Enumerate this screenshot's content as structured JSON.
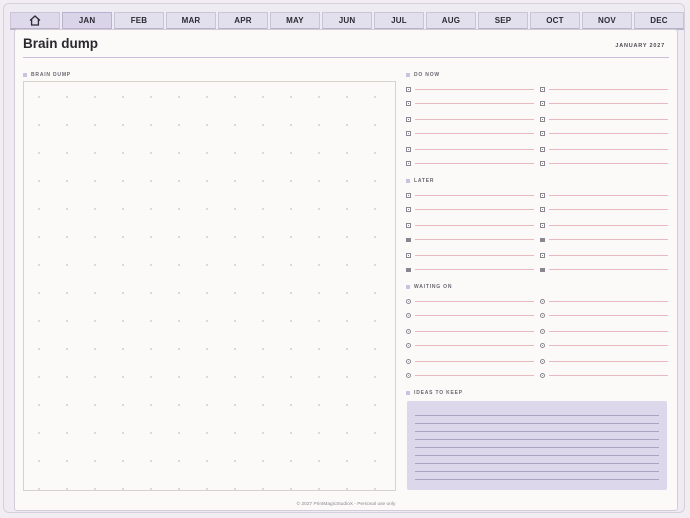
{
  "tabs": {
    "home_icon": "home-icon",
    "months": [
      "JAN",
      "FEB",
      "MAR",
      "APR",
      "MAY",
      "JUN",
      "JUL",
      "AUG",
      "SEP",
      "OCT",
      "NOV",
      "DEC"
    ],
    "active": "JAN"
  },
  "page": {
    "title": "Brain dump",
    "date": "JANUARY 2027"
  },
  "sections": {
    "brain_dump": "BRAIN DUMP",
    "do_now": "DO NOW",
    "later": "LATER",
    "waiting_on": "WAITING ON",
    "ideas_to_keep": "IDEAS TO KEEP"
  },
  "footer": "© 2027 PrintMagicStudioX - Personal use only",
  "colors": {
    "tab_bg": "#e3e0ee",
    "accent_lavender": "#dcd7ea",
    "task_line_pink": "#e8b9c0"
  }
}
